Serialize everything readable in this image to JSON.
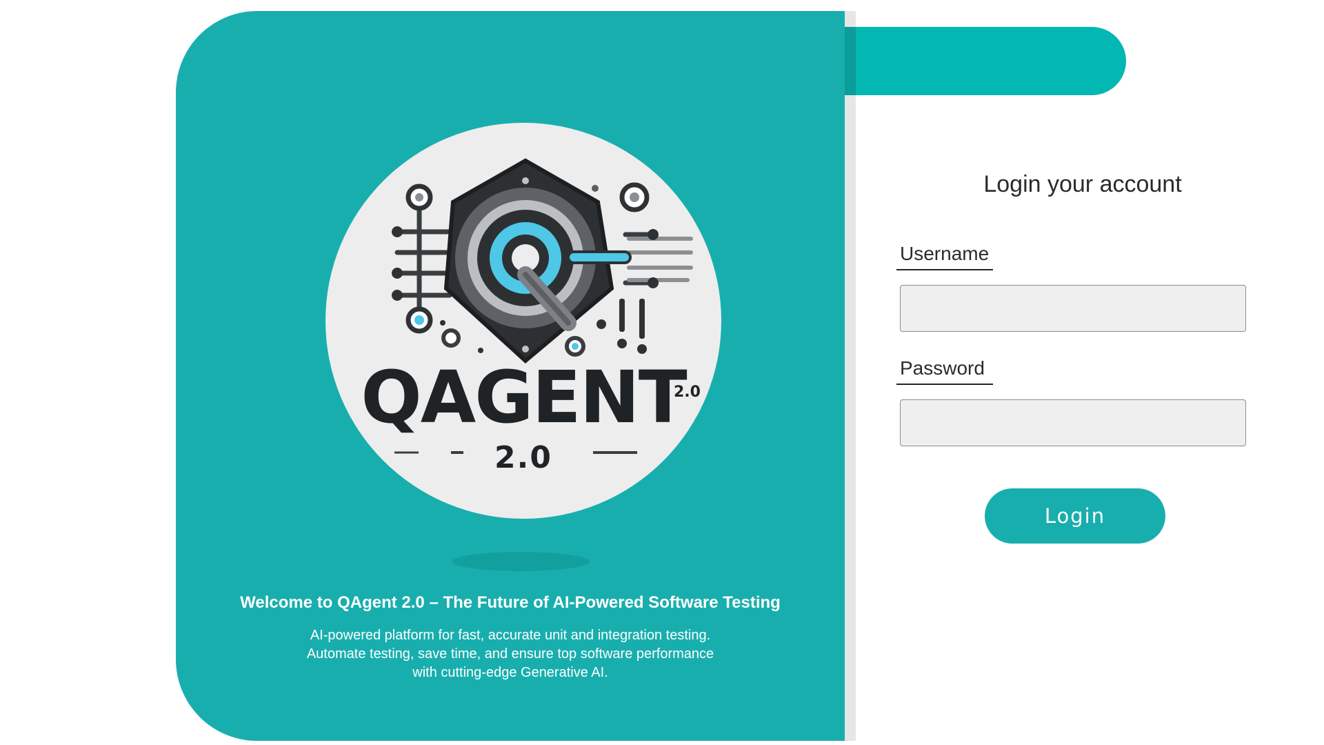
{
  "brand": {
    "logo_wordmark": "QAGENT",
    "logo_superscript": "2.0",
    "logo_version": "2.0",
    "primary_color": "#19aeae",
    "accent_color": "#03b7b3"
  },
  "welcome": {
    "title": "Welcome to QAgent 2.0 – The Future of AI-Powered Software Testing",
    "description_lines": [
      "AI-powered platform for fast, accurate unit and integration testing.",
      "Automate testing, save time, and ensure top software performance",
      "with cutting-edge Generative AI."
    ]
  },
  "login": {
    "heading": "Login your account",
    "username_label": "Username",
    "username_value": "",
    "password_label": "Password",
    "password_value": "",
    "submit_label": "Login"
  },
  "icons": {
    "logo": "qagent-circuit-hexagon-logo"
  }
}
